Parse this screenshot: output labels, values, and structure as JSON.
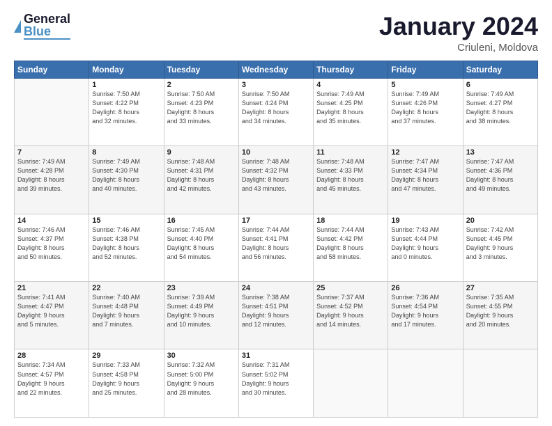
{
  "header": {
    "logo_general": "General",
    "logo_blue": "Blue",
    "main_title": "January 2024",
    "subtitle": "Criuleni, Moldova"
  },
  "calendar": {
    "days_of_week": [
      "Sunday",
      "Monday",
      "Tuesday",
      "Wednesday",
      "Thursday",
      "Friday",
      "Saturday"
    ],
    "weeks": [
      [
        {
          "day": "",
          "info": ""
        },
        {
          "day": "1",
          "info": "Sunrise: 7:50 AM\nSunset: 4:22 PM\nDaylight: 8 hours\nand 32 minutes."
        },
        {
          "day": "2",
          "info": "Sunrise: 7:50 AM\nSunset: 4:23 PM\nDaylight: 8 hours\nand 33 minutes."
        },
        {
          "day": "3",
          "info": "Sunrise: 7:50 AM\nSunset: 4:24 PM\nDaylight: 8 hours\nand 34 minutes."
        },
        {
          "day": "4",
          "info": "Sunrise: 7:49 AM\nSunset: 4:25 PM\nDaylight: 8 hours\nand 35 minutes."
        },
        {
          "day": "5",
          "info": "Sunrise: 7:49 AM\nSunset: 4:26 PM\nDaylight: 8 hours\nand 37 minutes."
        },
        {
          "day": "6",
          "info": "Sunrise: 7:49 AM\nSunset: 4:27 PM\nDaylight: 8 hours\nand 38 minutes."
        }
      ],
      [
        {
          "day": "7",
          "info": "Sunrise: 7:49 AM\nSunset: 4:28 PM\nDaylight: 8 hours\nand 39 minutes."
        },
        {
          "day": "8",
          "info": "Sunrise: 7:49 AM\nSunset: 4:30 PM\nDaylight: 8 hours\nand 40 minutes."
        },
        {
          "day": "9",
          "info": "Sunrise: 7:48 AM\nSunset: 4:31 PM\nDaylight: 8 hours\nand 42 minutes."
        },
        {
          "day": "10",
          "info": "Sunrise: 7:48 AM\nSunset: 4:32 PM\nDaylight: 8 hours\nand 43 minutes."
        },
        {
          "day": "11",
          "info": "Sunrise: 7:48 AM\nSunset: 4:33 PM\nDaylight: 8 hours\nand 45 minutes."
        },
        {
          "day": "12",
          "info": "Sunrise: 7:47 AM\nSunset: 4:34 PM\nDaylight: 8 hours\nand 47 minutes."
        },
        {
          "day": "13",
          "info": "Sunrise: 7:47 AM\nSunset: 4:36 PM\nDaylight: 8 hours\nand 49 minutes."
        }
      ],
      [
        {
          "day": "14",
          "info": "Sunrise: 7:46 AM\nSunset: 4:37 PM\nDaylight: 8 hours\nand 50 minutes."
        },
        {
          "day": "15",
          "info": "Sunrise: 7:46 AM\nSunset: 4:38 PM\nDaylight: 8 hours\nand 52 minutes."
        },
        {
          "day": "16",
          "info": "Sunrise: 7:45 AM\nSunset: 4:40 PM\nDaylight: 8 hours\nand 54 minutes."
        },
        {
          "day": "17",
          "info": "Sunrise: 7:44 AM\nSunset: 4:41 PM\nDaylight: 8 hours\nand 56 minutes."
        },
        {
          "day": "18",
          "info": "Sunrise: 7:44 AM\nSunset: 4:42 PM\nDaylight: 8 hours\nand 58 minutes."
        },
        {
          "day": "19",
          "info": "Sunrise: 7:43 AM\nSunset: 4:44 PM\nDaylight: 9 hours\nand 0 minutes."
        },
        {
          "day": "20",
          "info": "Sunrise: 7:42 AM\nSunset: 4:45 PM\nDaylight: 9 hours\nand 3 minutes."
        }
      ],
      [
        {
          "day": "21",
          "info": "Sunrise: 7:41 AM\nSunset: 4:47 PM\nDaylight: 9 hours\nand 5 minutes."
        },
        {
          "day": "22",
          "info": "Sunrise: 7:40 AM\nSunset: 4:48 PM\nDaylight: 9 hours\nand 7 minutes."
        },
        {
          "day": "23",
          "info": "Sunrise: 7:39 AM\nSunset: 4:49 PM\nDaylight: 9 hours\nand 10 minutes."
        },
        {
          "day": "24",
          "info": "Sunrise: 7:38 AM\nSunset: 4:51 PM\nDaylight: 9 hours\nand 12 minutes."
        },
        {
          "day": "25",
          "info": "Sunrise: 7:37 AM\nSunset: 4:52 PM\nDaylight: 9 hours\nand 14 minutes."
        },
        {
          "day": "26",
          "info": "Sunrise: 7:36 AM\nSunset: 4:54 PM\nDaylight: 9 hours\nand 17 minutes."
        },
        {
          "day": "27",
          "info": "Sunrise: 7:35 AM\nSunset: 4:55 PM\nDaylight: 9 hours\nand 20 minutes."
        }
      ],
      [
        {
          "day": "28",
          "info": "Sunrise: 7:34 AM\nSunset: 4:57 PM\nDaylight: 9 hours\nand 22 minutes."
        },
        {
          "day": "29",
          "info": "Sunrise: 7:33 AM\nSunset: 4:58 PM\nDaylight: 9 hours\nand 25 minutes."
        },
        {
          "day": "30",
          "info": "Sunrise: 7:32 AM\nSunset: 5:00 PM\nDaylight: 9 hours\nand 28 minutes."
        },
        {
          "day": "31",
          "info": "Sunrise: 7:31 AM\nSunset: 5:02 PM\nDaylight: 9 hours\nand 30 minutes."
        },
        {
          "day": "",
          "info": ""
        },
        {
          "day": "",
          "info": ""
        },
        {
          "day": "",
          "info": ""
        }
      ]
    ]
  }
}
